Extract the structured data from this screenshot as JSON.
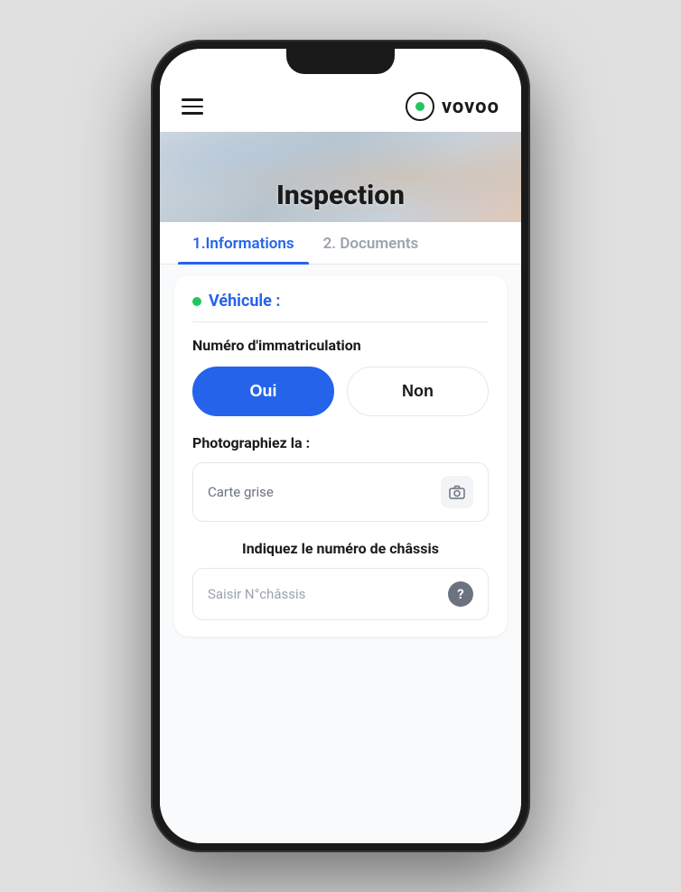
{
  "app": {
    "logo_text": "vovoo",
    "title": "Inspection"
  },
  "header": {
    "menu_label": "menu",
    "logo_icon_label": "vovoo-logo-icon"
  },
  "tabs": [
    {
      "id": "informations",
      "label": "1.Informations",
      "active": true
    },
    {
      "id": "documents",
      "label": "2. Documents",
      "active": false
    }
  ],
  "section": {
    "title": "Véhicule :",
    "fields": [
      {
        "id": "immatriculation",
        "label": "Numéro d'immatriculation",
        "type": "toggle",
        "options": [
          {
            "id": "oui",
            "label": "Oui",
            "active": true
          },
          {
            "id": "non",
            "label": "Non",
            "active": false
          }
        ]
      },
      {
        "id": "carte_grise",
        "label": "Photographiez la :",
        "type": "photo",
        "placeholder": "Carte grise"
      },
      {
        "id": "chassis",
        "label": "Indiquez le numéro de châssis",
        "type": "text",
        "placeholder": "Saisir N°châssis"
      }
    ]
  }
}
